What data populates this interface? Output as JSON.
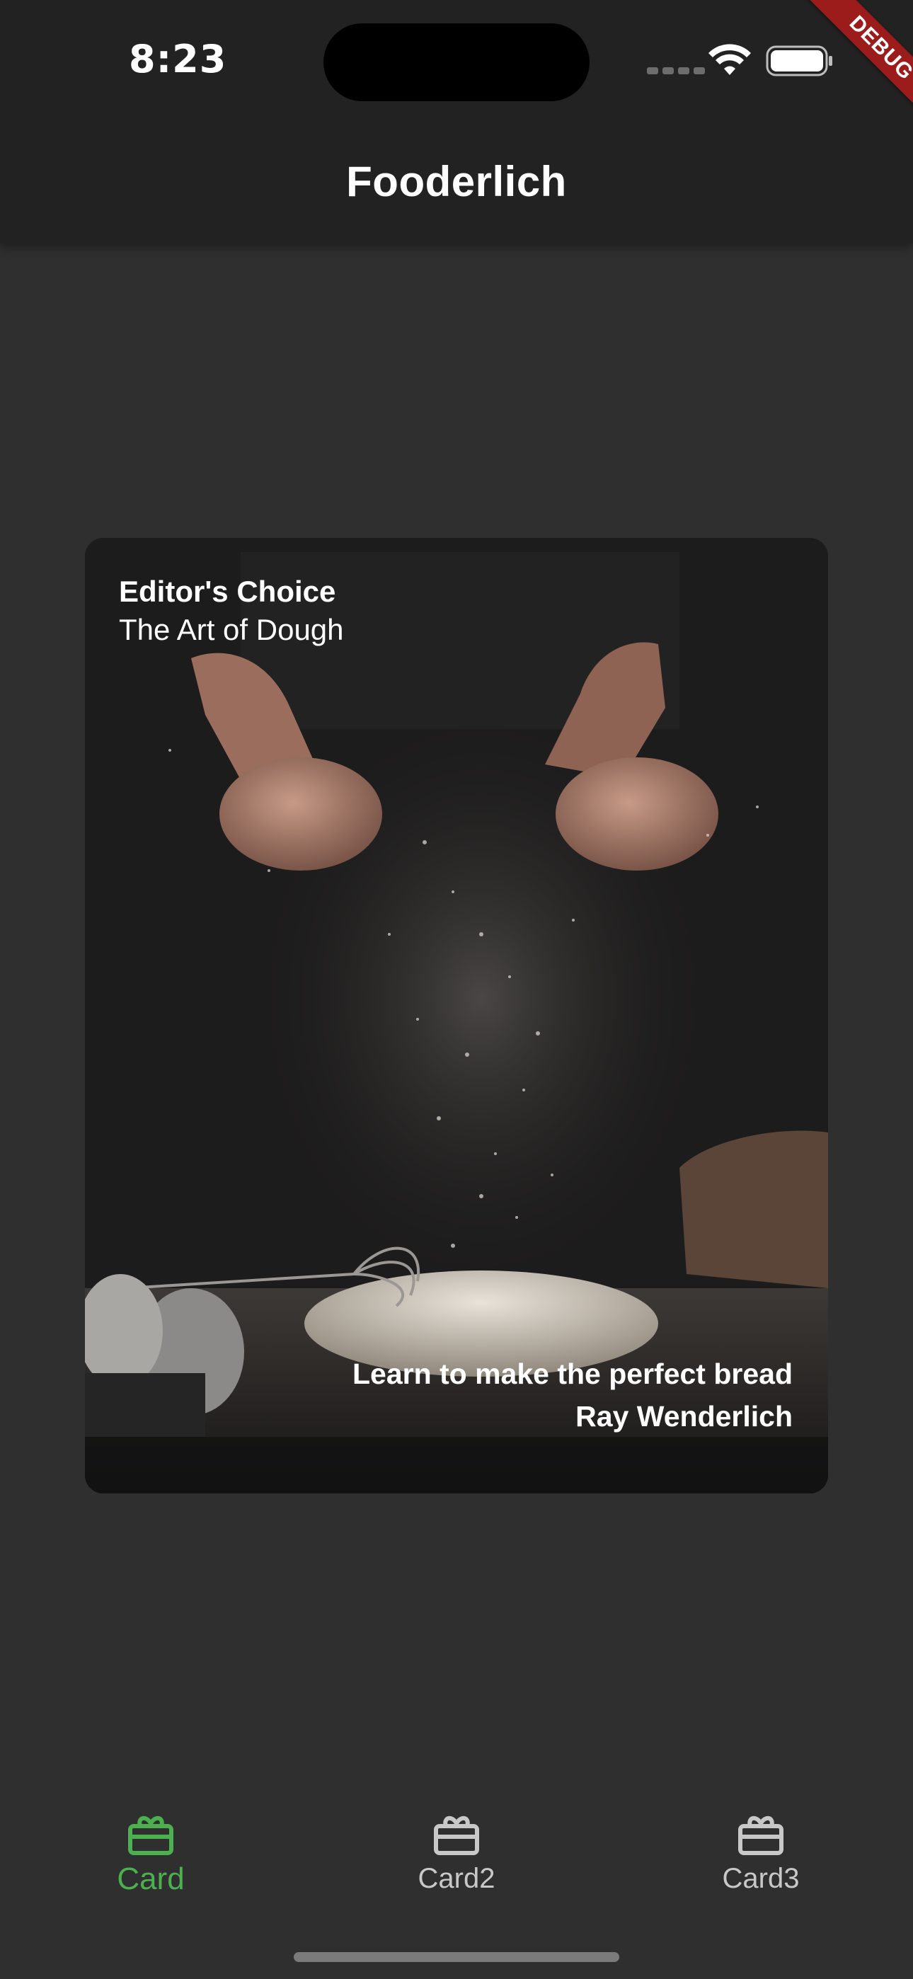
{
  "status_bar": {
    "time": "8:23"
  },
  "app_bar": {
    "title": "Fooderlich"
  },
  "debug_banner": {
    "label": "DEBUG"
  },
  "card": {
    "category": "Editor's Choice",
    "title": "The Art of Dough",
    "description": "Learn to make the perfect bread",
    "author": "Ray Wenderlich"
  },
  "bottom_nav": {
    "items": [
      {
        "label": "Card",
        "icon": "card-giftcard-icon",
        "active": true
      },
      {
        "label": "Card2",
        "icon": "card-giftcard-icon",
        "active": false
      },
      {
        "label": "Card3",
        "icon": "card-giftcard-icon",
        "active": false
      }
    ]
  },
  "colors": {
    "active": "#4caf50",
    "inactive": "#c8c8c8",
    "background": "#2f2f2f",
    "app_bar": "#222222",
    "debug": "#9c1c1c"
  }
}
